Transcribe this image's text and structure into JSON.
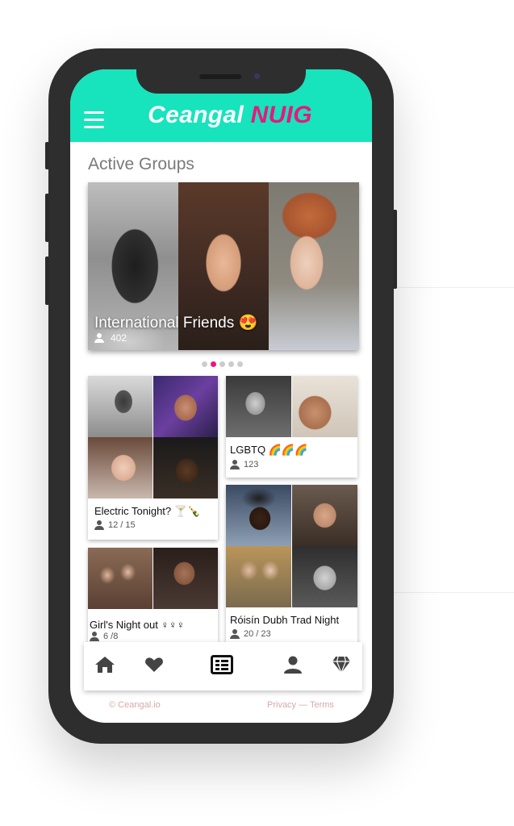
{
  "app": {
    "title_white": "Ceangal",
    "title_pink": "NUIG",
    "header_color": "#17e3bc",
    "accent_color": "#e8177f"
  },
  "section": {
    "title": "Active Groups"
  },
  "hero": {
    "name": "International Friends 😍",
    "count": "402",
    "carousel_pages": 5,
    "active_page": 2
  },
  "groups": {
    "electric": {
      "name": "Electric Tonight? 🍸🍾",
      "count": "12 / 15"
    },
    "girls": {
      "name": "Girl's Night out ♀♀♀",
      "count": "6 /8"
    },
    "lgbtq": {
      "name": "LGBTQ 🌈🌈🌈",
      "count": "123"
    },
    "roisin": {
      "name": "Róisín Dubh Trad Night",
      "count": "20 / 23"
    }
  },
  "nav": {
    "items": [
      "home-icon",
      "heart-icon",
      "list-icon",
      "user-icon",
      "diamond-icon"
    ],
    "active": "list-icon"
  },
  "footer": {
    "copyright": "© Ceangal.io",
    "links": "Privacy — Terms"
  }
}
